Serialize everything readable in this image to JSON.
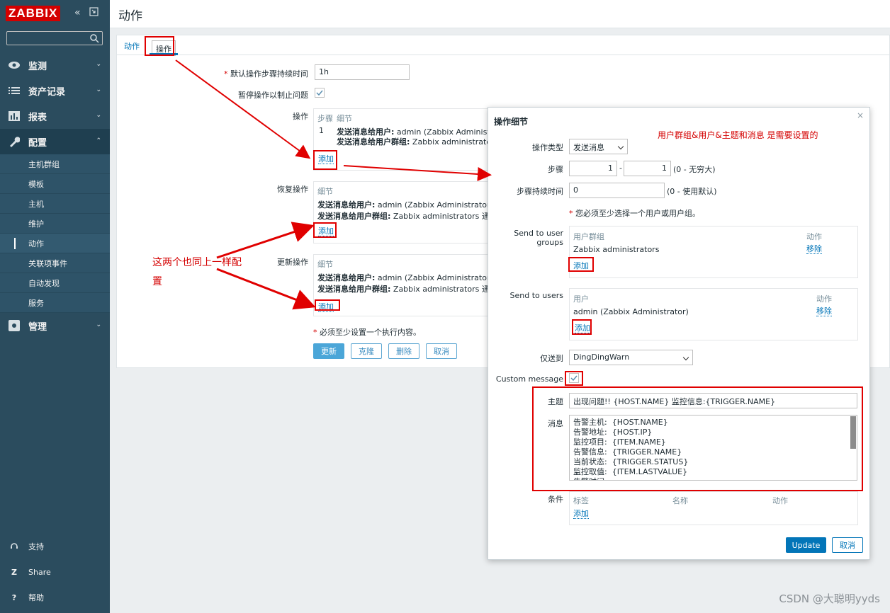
{
  "brand": {
    "logo": "ZABBIX"
  },
  "sidebar": {
    "nav": [
      {
        "label": "监测",
        "icon": "eye-icon"
      },
      {
        "label": "资产记录",
        "icon": "list-icon"
      },
      {
        "label": "报表",
        "icon": "bar-chart-icon"
      },
      {
        "label": "配置",
        "icon": "wrench-icon"
      },
      {
        "label": "管理",
        "icon": "gear-icon"
      }
    ],
    "sub": [
      "主机群组",
      "模板",
      "主机",
      "维护",
      "动作",
      "关联项事件",
      "自动发现",
      "服务"
    ],
    "bottom": [
      {
        "label": "支持",
        "icon": "headset-icon"
      },
      {
        "label": "Share",
        "icon": "share-icon",
        "glyph": "Z"
      },
      {
        "label": "帮助",
        "icon": "help-icon",
        "glyph": "?"
      }
    ]
  },
  "header": {
    "title": "动作"
  },
  "tabs": {
    "action": "动作",
    "operations": "操作"
  },
  "form": {
    "default_step_label": "默认操作步骤持续时间",
    "default_step_value": "1h",
    "pause_label": "暂停操作以制止问题",
    "operations_label": "操作",
    "recovery_label": "恢复操作",
    "update_label": "更新操作",
    "col_step": "步骤",
    "col_detail": "细节",
    "op_step_num": "1",
    "op_line1_bold": "发送消息给用户:",
    "op_line1_rest": " admin (Zabbix Administrator) 通过",
    "op_line2_bold": "发送消息给用户群组:",
    "op_line2_rest": " Zabbix administrators 通过",
    "rec_line1_bold": "发送消息给用户:",
    "rec_line1_rest": " admin (Zabbix Administrator) 通过 D",
    "rec_line2_bold": "发送消息给用户群组:",
    "rec_line2_rest": " Zabbix administrators 通过 D",
    "add": "添加",
    "must_note": "必须至少设置一个执行内容。",
    "btn_update": "更新",
    "btn_clone": "克隆",
    "btn_delete": "删除",
    "btn_cancel": "取消"
  },
  "dialog": {
    "title": "操作细节",
    "close": "×",
    "op_type_label": "操作类型",
    "op_type_value": "发送消息",
    "steps_label": "步骤",
    "step_from": "1",
    "step_to": "1",
    "steps_hint": "(0 - 无穷大)",
    "step_dur_label": "步骤持续时间",
    "step_dur_value": "0",
    "step_dur_hint": "(0 - 使用默认)",
    "must_select": "您必须至少选择一个用户或用户组。",
    "groups_label": "Send to user groups",
    "groups_col": "用户群组",
    "action_col": "动作",
    "group_name": "Zabbix administrators",
    "remove": "移除",
    "users_label": "Send to users",
    "users_col": "用户",
    "user_name": "admin (Zabbix Administrator)",
    "add": "添加",
    "sendto_label": "仅送到",
    "sendto_value": "DingDingWarn",
    "custom_label": "Custom message",
    "subject_label": "主题",
    "subject_value": "出现问题!! {HOST.NAME} 监控信息:{TRIGGER.NAME}",
    "message_label": "消息",
    "message_value": "告警主机:  {HOST.NAME}\n告警地址:  {HOST.IP}\n监控项目:  {ITEM.NAME}\n告警信息:  {TRIGGER.NAME}\n当前状态:  {TRIGGER.STATUS}\n监控取值:  {ITEM.LASTVALUE}\n告警时间:",
    "cond_label": "条件",
    "cond_col_tag": "标签",
    "cond_col_name": "名称",
    "cond_col_action": "动作",
    "btn_update": "Update",
    "btn_cancel": "取消"
  },
  "annotations": {
    "note_top": "用户群组&用户&主题和消息   是需要设置的",
    "note_left_1": "这两个也同上一样配",
    "note_left_2": "置"
  },
  "watermark": "CSDN @大聪明yyds",
  "colors": {
    "accent": "#0275b8",
    "sidebar": "#2b4c5e",
    "annotation": "#e00000",
    "logo": "#d40000"
  }
}
